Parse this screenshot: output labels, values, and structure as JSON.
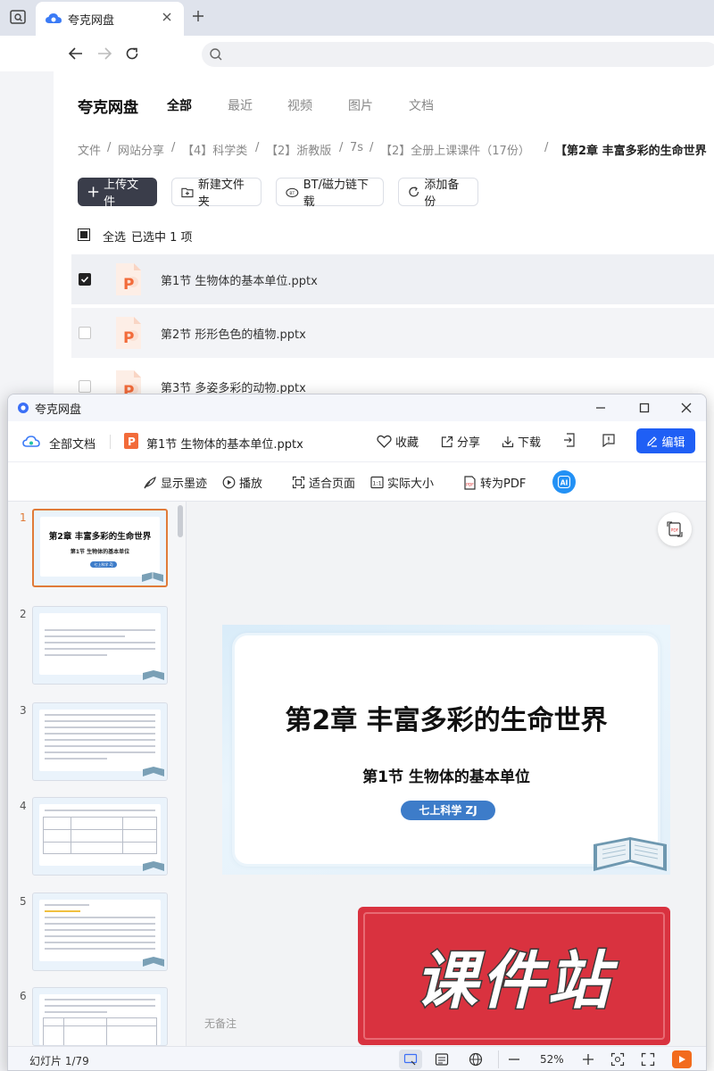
{
  "browser": {
    "tab_title": "夸克网盘"
  },
  "drive": {
    "logo": "夸克网盘",
    "nav_tabs": [
      "全部",
      "最近",
      "视频",
      "图片",
      "文档"
    ],
    "active_tab": "全部",
    "breadcrumb": [
      "文件",
      "网站分享",
      "【4】科学类",
      "【2】浙教版",
      "7s",
      "【2】全册上课课件（17份）",
      "【第2章 丰富多彩的生命世界"
    ],
    "breadcrumb_sep": "/",
    "actions": {
      "upload": "上传文件",
      "new_folder": "新建文件夹",
      "bt_download": "BT/磁力链下载",
      "add_backup": "添加备份"
    },
    "select_all": "全选",
    "selected_count": "已选中 1 项",
    "files": [
      {
        "name": "第1节 生物体的基本单位.pptx",
        "checked": true
      },
      {
        "name": "第2节 形形色色的植物.pptx",
        "checked": false
      },
      {
        "name": "第3节 多姿多彩的动物.pptx",
        "checked": false
      }
    ]
  },
  "viewer": {
    "window_title": "夸克网盘",
    "all_docs": "全部文档",
    "file_name": "第1节 生物体的基本单位.pptx",
    "favorite": "收藏",
    "share": "分享",
    "download": "下载",
    "edit": "编辑",
    "tools": {
      "ink": "显示墨迹",
      "play": "播放",
      "fit_page": "适合页面",
      "actual_size": "实际大小",
      "to_pdf": "转为PDF",
      "ai": "AI"
    },
    "thumb_numbers": [
      "1",
      "2",
      "3",
      "4",
      "5",
      "6"
    ],
    "thumb1": {
      "title": "第2章 丰富多彩的生命世界",
      "subtitle": "第1节 生物体的基本单位",
      "tag": "七上科学 ZJ"
    },
    "slide": {
      "title": "第2章  丰富多彩的生命世界",
      "subtitle": "第1节  生物体的基本单位",
      "tag": "七上科学  ZJ"
    },
    "notes_placeholder": "无备注",
    "watermark": "课件站",
    "pdf_badge": "PDF",
    "status": {
      "slide_counter": "幻灯片 1/79",
      "zoom": "52%"
    }
  },
  "colors": {
    "accent_blue": "#1f5ff5",
    "upload_btn": "#3a3d4a",
    "ppt_orange": "#f26b3a",
    "tag_blue": "#3d7cc9",
    "watermark_red": "#d9323f"
  }
}
